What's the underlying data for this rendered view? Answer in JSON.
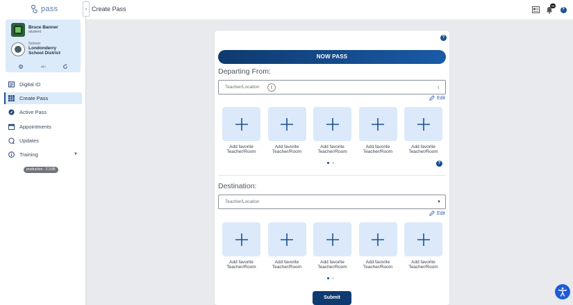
{
  "app": {
    "logo_text": "pass"
  },
  "profile": {
    "name": "Bruce Banner",
    "role": "student",
    "school_label": "School",
    "school_name_line1": "Londonderry",
    "school_name_line2": "School District"
  },
  "sidebar": {
    "items": [
      {
        "label": "Digital ID",
        "icon": "id-card-icon"
      },
      {
        "label": "Create Pass",
        "icon": "grid-icon",
        "active": true
      },
      {
        "label": "Active Pass",
        "icon": "compass-icon"
      },
      {
        "label": "Appointments",
        "icon": "calendar-icon"
      },
      {
        "label": "Updates",
        "icon": "updates-icon"
      },
      {
        "label": "Training",
        "icon": "info-icon",
        "expandable": true
      }
    ],
    "version": "production - 2.3.86"
  },
  "header": {
    "title": "Create Pass",
    "notification_count": "99"
  },
  "form": {
    "mode_label": "NOW PASS",
    "departing_label": "Departing From:",
    "departing_placeholder": "Teacher/Location",
    "destination_label": "Destination:",
    "destination_placeholder": "Teacher/Location",
    "edit_label": "Edit",
    "favorites": [
      {
        "line1": "Add favorite",
        "line2": "Teacher/Room"
      },
      {
        "line1": "Add favorite",
        "line2": "Teacher/Room"
      },
      {
        "line1": "Add favorite",
        "line2": "Teacher/Room"
      },
      {
        "line1": "Add favorite",
        "line2": "Teacher/Room"
      },
      {
        "line1": "Add favorite",
        "line2": "Teacher/Room"
      }
    ],
    "submit_label": "Submit"
  },
  "colors": {
    "primary": "#0e3a6f",
    "accent": "#1a4f8f",
    "fav_bg": "#dbe9fa",
    "a11y": "#1e5bd6"
  }
}
